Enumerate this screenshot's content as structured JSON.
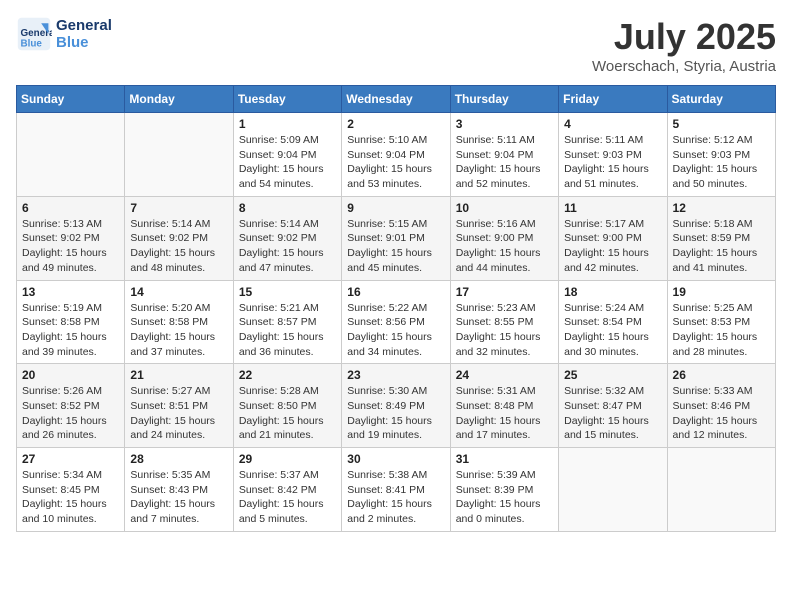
{
  "header": {
    "logo_line1": "General",
    "logo_line2": "Blue",
    "month": "July 2025",
    "location": "Woerschach, Styria, Austria"
  },
  "weekdays": [
    "Sunday",
    "Monday",
    "Tuesday",
    "Wednesday",
    "Thursday",
    "Friday",
    "Saturday"
  ],
  "weeks": [
    [
      {
        "day": "",
        "info": ""
      },
      {
        "day": "",
        "info": ""
      },
      {
        "day": "1",
        "info": "Sunrise: 5:09 AM\nSunset: 9:04 PM\nDaylight: 15 hours and 54 minutes."
      },
      {
        "day": "2",
        "info": "Sunrise: 5:10 AM\nSunset: 9:04 PM\nDaylight: 15 hours and 53 minutes."
      },
      {
        "day": "3",
        "info": "Sunrise: 5:11 AM\nSunset: 9:04 PM\nDaylight: 15 hours and 52 minutes."
      },
      {
        "day": "4",
        "info": "Sunrise: 5:11 AM\nSunset: 9:03 PM\nDaylight: 15 hours and 51 minutes."
      },
      {
        "day": "5",
        "info": "Sunrise: 5:12 AM\nSunset: 9:03 PM\nDaylight: 15 hours and 50 minutes."
      }
    ],
    [
      {
        "day": "6",
        "info": "Sunrise: 5:13 AM\nSunset: 9:02 PM\nDaylight: 15 hours and 49 minutes."
      },
      {
        "day": "7",
        "info": "Sunrise: 5:14 AM\nSunset: 9:02 PM\nDaylight: 15 hours and 48 minutes."
      },
      {
        "day": "8",
        "info": "Sunrise: 5:14 AM\nSunset: 9:02 PM\nDaylight: 15 hours and 47 minutes."
      },
      {
        "day": "9",
        "info": "Sunrise: 5:15 AM\nSunset: 9:01 PM\nDaylight: 15 hours and 45 minutes."
      },
      {
        "day": "10",
        "info": "Sunrise: 5:16 AM\nSunset: 9:00 PM\nDaylight: 15 hours and 44 minutes."
      },
      {
        "day": "11",
        "info": "Sunrise: 5:17 AM\nSunset: 9:00 PM\nDaylight: 15 hours and 42 minutes."
      },
      {
        "day": "12",
        "info": "Sunrise: 5:18 AM\nSunset: 8:59 PM\nDaylight: 15 hours and 41 minutes."
      }
    ],
    [
      {
        "day": "13",
        "info": "Sunrise: 5:19 AM\nSunset: 8:58 PM\nDaylight: 15 hours and 39 minutes."
      },
      {
        "day": "14",
        "info": "Sunrise: 5:20 AM\nSunset: 8:58 PM\nDaylight: 15 hours and 37 minutes."
      },
      {
        "day": "15",
        "info": "Sunrise: 5:21 AM\nSunset: 8:57 PM\nDaylight: 15 hours and 36 minutes."
      },
      {
        "day": "16",
        "info": "Sunrise: 5:22 AM\nSunset: 8:56 PM\nDaylight: 15 hours and 34 minutes."
      },
      {
        "day": "17",
        "info": "Sunrise: 5:23 AM\nSunset: 8:55 PM\nDaylight: 15 hours and 32 minutes."
      },
      {
        "day": "18",
        "info": "Sunrise: 5:24 AM\nSunset: 8:54 PM\nDaylight: 15 hours and 30 minutes."
      },
      {
        "day": "19",
        "info": "Sunrise: 5:25 AM\nSunset: 8:53 PM\nDaylight: 15 hours and 28 minutes."
      }
    ],
    [
      {
        "day": "20",
        "info": "Sunrise: 5:26 AM\nSunset: 8:52 PM\nDaylight: 15 hours and 26 minutes."
      },
      {
        "day": "21",
        "info": "Sunrise: 5:27 AM\nSunset: 8:51 PM\nDaylight: 15 hours and 24 minutes."
      },
      {
        "day": "22",
        "info": "Sunrise: 5:28 AM\nSunset: 8:50 PM\nDaylight: 15 hours and 21 minutes."
      },
      {
        "day": "23",
        "info": "Sunrise: 5:30 AM\nSunset: 8:49 PM\nDaylight: 15 hours and 19 minutes."
      },
      {
        "day": "24",
        "info": "Sunrise: 5:31 AM\nSunset: 8:48 PM\nDaylight: 15 hours and 17 minutes."
      },
      {
        "day": "25",
        "info": "Sunrise: 5:32 AM\nSunset: 8:47 PM\nDaylight: 15 hours and 15 minutes."
      },
      {
        "day": "26",
        "info": "Sunrise: 5:33 AM\nSunset: 8:46 PM\nDaylight: 15 hours and 12 minutes."
      }
    ],
    [
      {
        "day": "27",
        "info": "Sunrise: 5:34 AM\nSunset: 8:45 PM\nDaylight: 15 hours and 10 minutes."
      },
      {
        "day": "28",
        "info": "Sunrise: 5:35 AM\nSunset: 8:43 PM\nDaylight: 15 hours and 7 minutes."
      },
      {
        "day": "29",
        "info": "Sunrise: 5:37 AM\nSunset: 8:42 PM\nDaylight: 15 hours and 5 minutes."
      },
      {
        "day": "30",
        "info": "Sunrise: 5:38 AM\nSunset: 8:41 PM\nDaylight: 15 hours and 2 minutes."
      },
      {
        "day": "31",
        "info": "Sunrise: 5:39 AM\nSunset: 8:39 PM\nDaylight: 15 hours and 0 minutes."
      },
      {
        "day": "",
        "info": ""
      },
      {
        "day": "",
        "info": ""
      }
    ]
  ]
}
